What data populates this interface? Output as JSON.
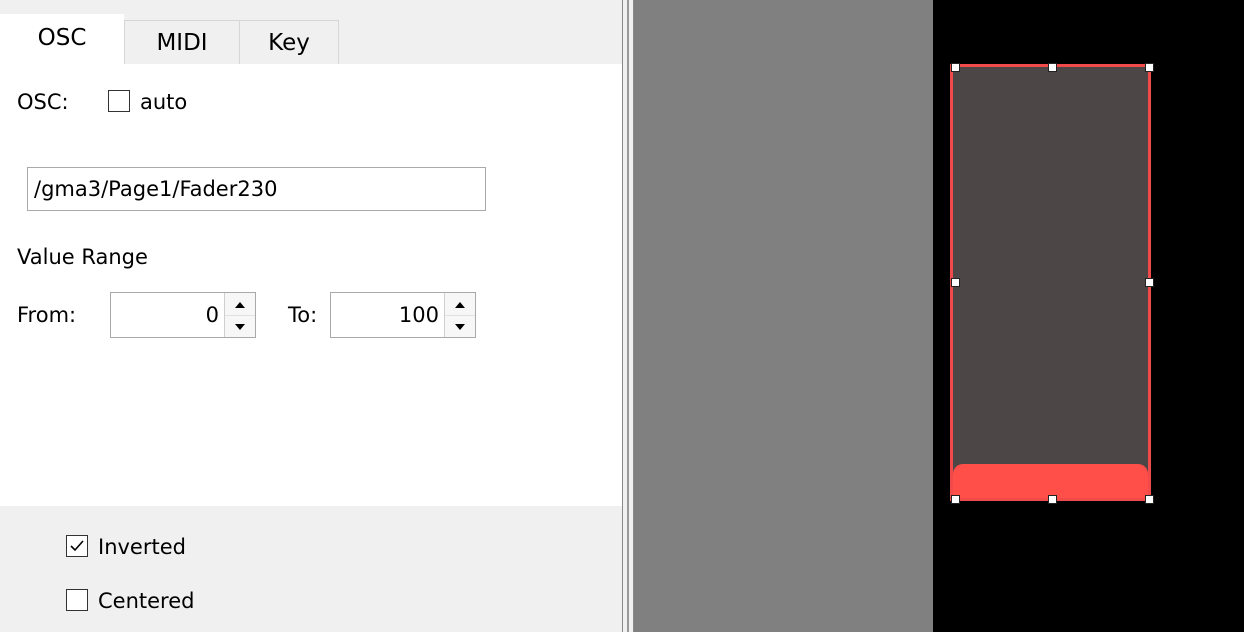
{
  "tabs": [
    "OSC",
    "MIDI",
    "Key"
  ],
  "osc": {
    "label": "OSC:",
    "auto_label": "auto",
    "auto_checked": false,
    "address": "/gma3/Page1/Fader230",
    "value_range_label": "Value Range",
    "from_label": "From:",
    "from_value": "0",
    "to_label": "To:",
    "to_value": "100"
  },
  "options": {
    "inverted_label": "Inverted",
    "inverted_checked": true,
    "centered_label": "Centered",
    "centered_checked": false
  },
  "colors": {
    "fader_border": "#f04b4a",
    "fader_fill": "#ff4f48",
    "fader_body": "#4d4646",
    "canvas_gray": "#808080",
    "canvas_black": "#000000"
  },
  "icons": [
    "check-icon",
    "spin-up-arrow-icon",
    "spin-down-arrow-icon"
  ]
}
